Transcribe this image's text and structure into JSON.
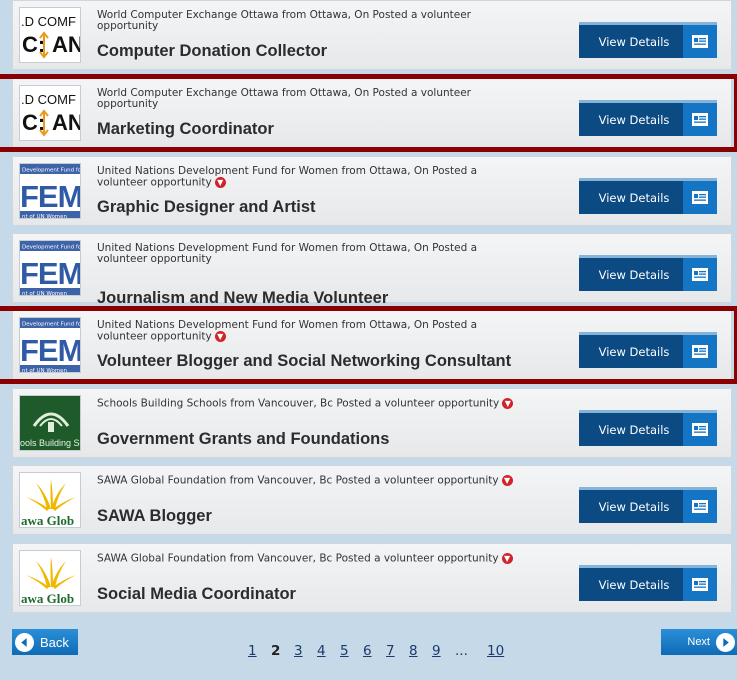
{
  "view_details_label": "View Details",
  "rows": [
    {
      "logo": "wce",
      "meta": "World Computer Exchange Ottawa from Ottawa, On Posted a volunteer opportunity",
      "title": "Computer Donation Collector",
      "chev": false
    },
    {
      "logo": "wce",
      "meta": "World Computer Exchange Ottawa from Ottawa, On Posted a volunteer opportunity",
      "title": "Marketing Coordinator",
      "chev": false
    },
    {
      "logo": "fem",
      "meta": "United Nations Development Fund for Women from Ottawa, On Posted a volunteer opportunity",
      "title": "Graphic Designer and Artist",
      "chev": true
    },
    {
      "logo": "fem",
      "meta": "United Nations Development Fund for Women from Ottawa, On Posted a volunteer opportunity",
      "title": "Journalism and New Media Volunteer",
      "chev": false
    },
    {
      "logo": "fem",
      "meta": "United Nations Development Fund for Women from Ottawa, On Posted a volunteer opportunity",
      "title": "Volunteer Blogger and Social Networking Consultant",
      "chev": true
    },
    {
      "logo": "sbs",
      "meta": "Schools Building Schools from Vancouver, Bc Posted a volunteer opportunity",
      "title": "Government Grants and Foundations",
      "chev": true
    },
    {
      "logo": "sawa",
      "meta": "SAWA Global Foundation from Vancouver, Bc Posted a volunteer opportunity",
      "title": "SAWA Blogger",
      "chev": true
    },
    {
      "logo": "sawa",
      "meta": "SAWA Global Foundation from Vancouver, Bc Posted a volunteer opportunity",
      "title": "Social Media Coordinator",
      "chev": true
    }
  ],
  "logos": {
    "wce": {
      "line1": ".D  COMF",
      "line2": "C:",
      "line3": "AN"
    },
    "fem": {
      "top": "Development Fund for",
      "mid": "FEM",
      "bot": "nt of UN Women"
    },
    "sbs": {
      "text": "ools Building Scho"
    },
    "sawa": {
      "text": "awa Glob"
    }
  },
  "pagination": {
    "back_label": "Back",
    "next_label": "Next",
    "pages": [
      "1",
      "2",
      "3",
      "4",
      "5",
      "6",
      "7",
      "8",
      "9",
      "...",
      "10"
    ],
    "current": "2"
  },
  "colors": {
    "highlight_border": "#8b0000",
    "button_dark": "#0b4a82",
    "button_icon": "#1475c5",
    "chevron": "#d0242b"
  }
}
